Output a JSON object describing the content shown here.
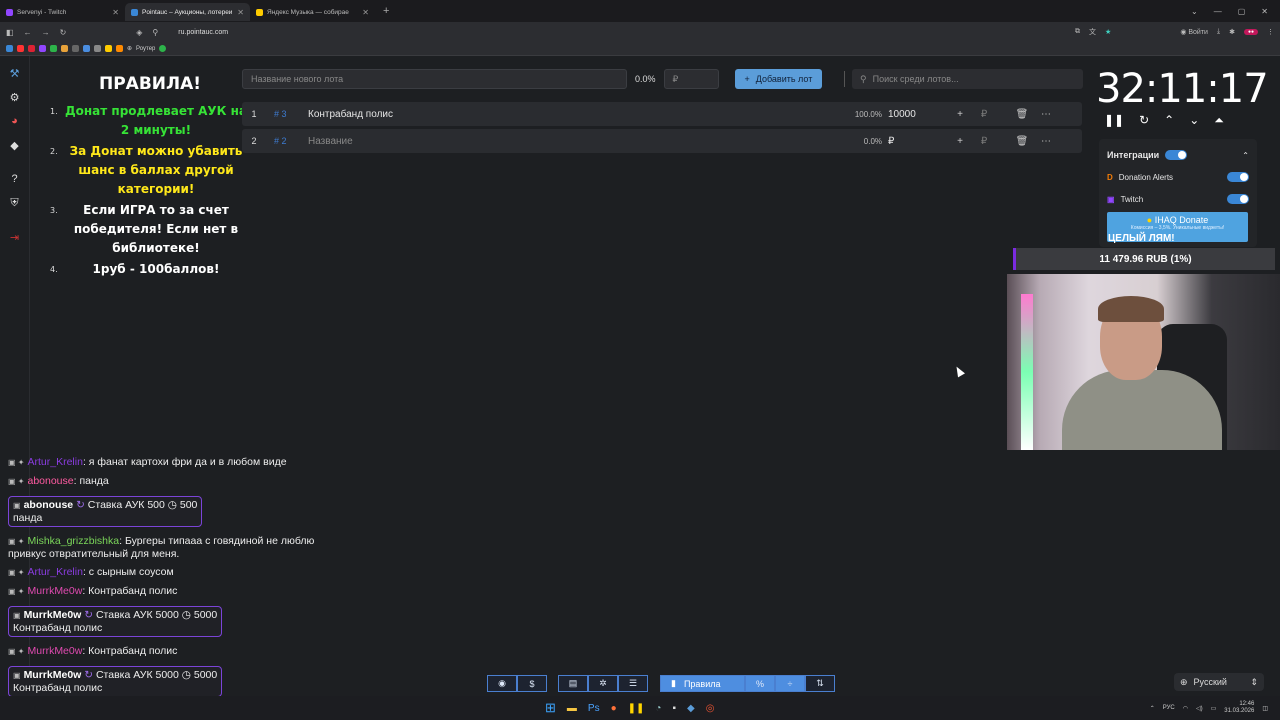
{
  "browser": {
    "tabs": [
      {
        "title": "Servenyi - Twitch",
        "color": "#9146ff",
        "active": false
      },
      {
        "title": "Pointauc – Аукционы, лотереи",
        "color": "#3a87d6",
        "active": true
      },
      {
        "title": "Яндекс Музыка — собирае",
        "color": "#ffcc00",
        "active": false
      }
    ],
    "url": "ru.pointauc.com",
    "login": "Войти",
    "bookmark_label": "Роутер"
  },
  "rules": {
    "title": "ПРАВИЛА!",
    "items": [
      {
        "num": "1.",
        "text": "Донат продлевает АУК на 2 минуты!"
      },
      {
        "num": "2.",
        "text": "За Донат можно убавить шанс в баллах другой категории!"
      },
      {
        "num": "3.",
        "text": "Если ИГРА то за счет победителя! Если нет в библиотеке!"
      },
      {
        "num": "4.",
        "text": "1руб - 100баллов!"
      }
    ]
  },
  "lot_form": {
    "name_placeholder": "Название нового лота",
    "percent": "0.0%",
    "currency": "₽",
    "add_label": "Добавить лот",
    "search_placeholder": "Поиск среди лотов..."
  },
  "lots": [
    {
      "index": "1",
      "tag": "# 3",
      "name": "Контрабанд полис",
      "percent": "100.0%",
      "amount": "10000",
      "placeholder": false
    },
    {
      "index": "2",
      "tag": "# 2",
      "name": "Название",
      "percent": "0.0%",
      "amount": "₽",
      "placeholder": true
    }
  ],
  "timer": {
    "value": "32:11:17"
  },
  "integrations": {
    "title": "Интеграции",
    "items": [
      {
        "name": "Donation Alerts"
      },
      {
        "name": "Twitch"
      }
    ],
    "donate_button": "IHAQ Donate",
    "donate_sub": "Комиссия – 3,5%. Уникальные виджеты!"
  },
  "goal": {
    "title": "ЦЕЛЫЙ ЛЯМ!",
    "progress_text": "11 479.96 RUB (1%)",
    "progress_fraction": 0.01
  },
  "chat": [
    {
      "type": "msg",
      "user": "Artur_Krelin",
      "text": ": я фанат картохи фри да и в любом виде",
      "cls": "u1"
    },
    {
      "type": "msg",
      "user": "abonouse",
      "text": ": панда",
      "cls": "u2"
    },
    {
      "type": "bid",
      "user": "abonouse",
      "bid": "Ставка АУК 500",
      "points": "500",
      "text": "панда"
    },
    {
      "type": "msg",
      "user": "Mishka_grizzbishka",
      "text": ": Бургеры типааа с говядиной не люблю привкус отвратительный для меня.",
      "cls": "u3"
    },
    {
      "type": "msg",
      "user": "Artur_Krelin",
      "text": ": с сырным соусом",
      "cls": "u1"
    },
    {
      "type": "msg",
      "user": "MurrkMe0w",
      "text": ": Контрабанд полис",
      "cls": "u4"
    },
    {
      "type": "bid",
      "user": "MurrkMe0w",
      "bid": "Ставка АУК 5000",
      "points": "5000",
      "text": "Контрабанд полис"
    },
    {
      "type": "msg",
      "user": "MurrkMe0w",
      "text": ": Контрабанд полис",
      "cls": "u4"
    },
    {
      "type": "bid",
      "user": "MurrkMe0w",
      "bid": "Ставка АУК 5000",
      "points": "5000",
      "text": "Контрабанд полис"
    }
  ],
  "toolbar": {
    "rules_label": "Правила"
  },
  "language": {
    "value": "Русский"
  },
  "tray": {
    "lang": "РУС",
    "time": "12:46",
    "date": "31.03.2026"
  }
}
